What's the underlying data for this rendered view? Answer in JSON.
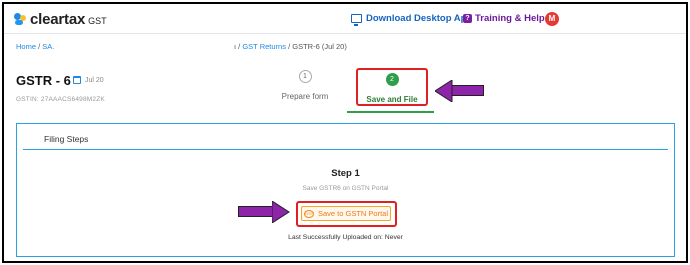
{
  "header": {
    "logo_text": "cleartax",
    "logo_sub": "GST",
    "download_label": "Download Desktop App",
    "help_label": "Training & Help",
    "avatar_initial": "M"
  },
  "breadcrumb": {
    "home": "Home",
    "sep1": " / ",
    "item2": "SA.",
    "mid_prefix": "ı / ",
    "gst_returns": "GST Returns",
    "sep2": " / ",
    "current": "GSTR-6 (Jul 20)"
  },
  "page": {
    "title": "GSTR - 6",
    "period": "Jul 20",
    "gstin": "GSTIN: 27AAACS6498M2ZK"
  },
  "stepper": [
    {
      "num": "1",
      "label": "Prepare form",
      "state": "inactive"
    },
    {
      "num": "2",
      "label": "Save and File",
      "state": "active"
    }
  ],
  "filing": {
    "title": "Filing Steps",
    "step_heading": "Step 1",
    "step_sub": "Save GSTR6 on GSTN Portal",
    "portal_icon": "GST",
    "portal_button": "Save to GSTN Portal",
    "last_uploaded": "Last Successfully Uploaded on: Never"
  },
  "colors": {
    "brand_blue": "#1e88e5",
    "active_green": "#2e9d4c",
    "highlight_red": "#e02020",
    "arrow_purple": "#8e24aa",
    "portal_orange": "#f07a10"
  }
}
